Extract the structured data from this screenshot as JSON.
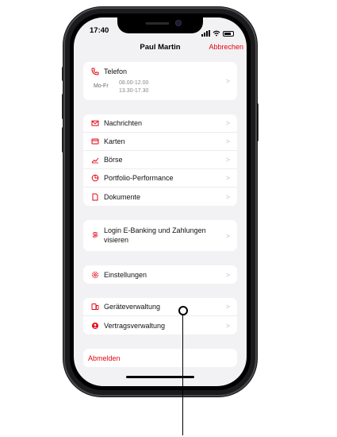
{
  "status_bar": {
    "time": "17:40"
  },
  "header": {
    "title": "Paul Martin",
    "cancel_label": "Abbrechen"
  },
  "contact": {
    "label": "Telefon",
    "days": "Mo-Fr",
    "hours_morning": "08.00-12.00",
    "hours_afternoon": "13.30-17.30"
  },
  "menu_main": [
    {
      "label": "Nachrichten",
      "icon": "envelope-icon"
    },
    {
      "label": "Karten",
      "icon": "card-icon"
    },
    {
      "label": "Börse",
      "icon": "trend-icon"
    },
    {
      "label": "Portfolio-Performance",
      "icon": "pie-chart-icon"
    },
    {
      "label": "Dokumente",
      "icon": "document-icon"
    }
  ],
  "login": {
    "label_line1": "Login E-Banking und Zahlungen",
    "label_line2": "visieren",
    "icon": "fingerprint-icon"
  },
  "settings": {
    "label": "Einstellungen",
    "icon": "gear-icon"
  },
  "devices": [
    {
      "label": "Geräteverwaltung",
      "icon": "devices-icon"
    },
    {
      "label": "Vertragsverwaltung",
      "icon": "user-circle-icon"
    }
  ],
  "logout": {
    "label": "Abmelden"
  },
  "chevron": ">",
  "colors": {
    "accent": "#e30613",
    "background": "#f2f2f4",
    "card": "#ffffff",
    "frame": "#1b1b1d"
  }
}
